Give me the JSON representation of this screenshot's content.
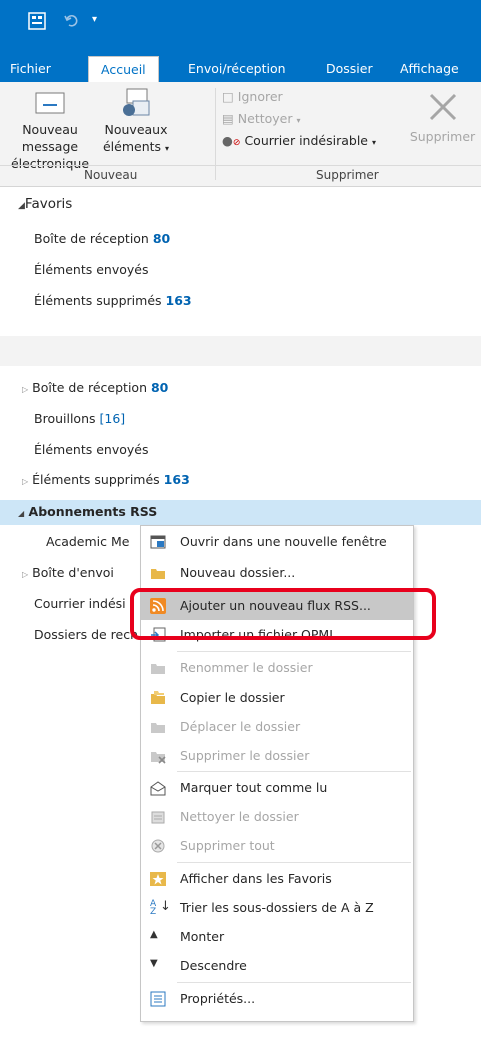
{
  "tabs": [
    "Fichier",
    "Accueil",
    "Envoi/réception",
    "Dossier",
    "Affichage"
  ],
  "ribbon": {
    "new_mail": "Nouveau message",
    "new_mail2": "électronique",
    "new_items": "Nouveaux",
    "new_items2": "éléments",
    "ignore": "Ignorer",
    "clean": "Nettoyer",
    "junk": "Courrier indésirable",
    "delete": "Supprimer",
    "group_new": "Nouveau",
    "group_delete": "Supprimer"
  },
  "favorites": {
    "header": "Favoris",
    "inbox": "Boîte de réception",
    "inbox_count": "80",
    "sent": "Éléments envoyés",
    "deleted": "Éléments supprimés",
    "deleted_count": "163"
  },
  "folders": {
    "inbox": "Boîte de réception",
    "inbox_count": "80",
    "drafts": "Brouillons",
    "drafts_count": "[16]",
    "sent": "Éléments envoyés",
    "deleted": "Éléments supprimés",
    "deleted_count": "163",
    "rss": "Abonnements RSS",
    "academic": "Academic Me",
    "outbox": "Boîte d'envoi",
    "junk": "Courrier indési",
    "search": "Dossiers de rech"
  },
  "menu": {
    "open_new_window": "Ouvrir dans une nouvelle fenêtre",
    "new_folder": "Nouveau dossier...",
    "add_rss": "Ajouter un nouveau flux RSS...",
    "import_opml": "Importer un fichier OPML",
    "rename": "Renommer le dossier",
    "copy": "Copier le dossier",
    "move": "Déplacer le dossier",
    "delete": "Supprimer le dossier",
    "mark_read": "Marquer tout comme lu",
    "clean": "Nettoyer le dossier",
    "delete_all": "Supprimer tout",
    "show_favorites": "Afficher dans les Favoris",
    "sort": "Trier les sous-dossiers de A à Z",
    "up": "Monter",
    "down": "Descendre",
    "properties": "Propriétés..."
  }
}
